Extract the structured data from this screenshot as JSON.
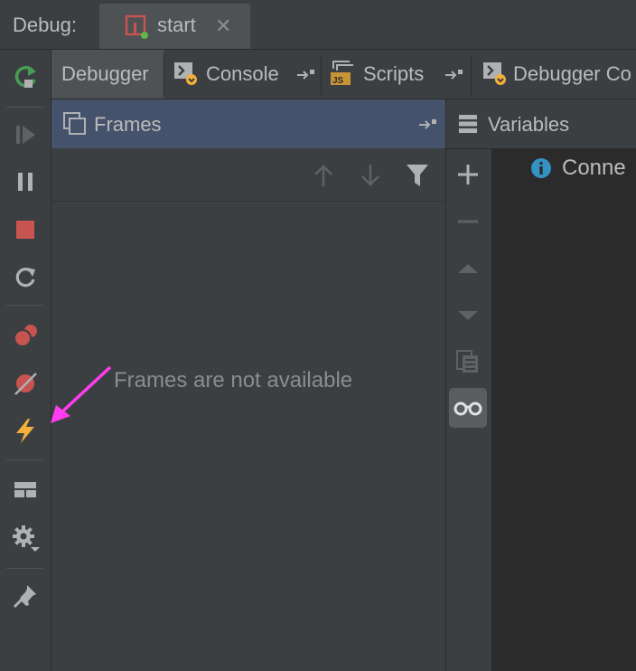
{
  "debug_bar": {
    "label": "Debug:",
    "run_config_tab": {
      "label": "start",
      "close_glyph": "✕"
    }
  },
  "tabs": [
    {
      "label": "Debugger",
      "icon": "none",
      "selected": true
    },
    {
      "label": "Console",
      "icon": "console-icon",
      "selected": false
    },
    {
      "label": "Scripts",
      "icon": "scripts-icon",
      "selected": false
    },
    {
      "label": "Debugger Co",
      "icon": "console-icon",
      "selected": false
    }
  ],
  "frames": {
    "title": "Frames",
    "empty_text": "Frames are not available"
  },
  "variables": {
    "title": "Variables",
    "entries": [
      {
        "text": "Conne",
        "icon": "info-icon"
      }
    ]
  },
  "left_toolbar": [
    "rerun-icon",
    "resume-icon",
    "pause-icon",
    "stop-icon",
    "restart-icon",
    "view-breakpoints-icon",
    "mute-breakpoints-icon",
    "lightning-icon",
    "layout-icon",
    "settings-icon",
    "pin-icon"
  ],
  "colors": {
    "background": "#3c3f41",
    "panel_header_selected": "#45526b",
    "stop_red": "#c75450",
    "rerun_green": "#499c54",
    "lightning_yellow": "#f4af3d",
    "annotation_arrow": "#ff3cf0",
    "info_blue": "#3592c4"
  }
}
